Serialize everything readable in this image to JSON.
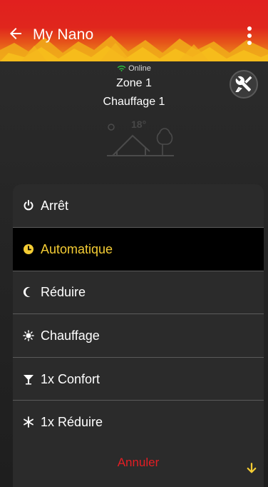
{
  "app_bar": {
    "title": "My Nano",
    "back_icon": "arrow-back-icon",
    "menu_icon": "more-vert-icon"
  },
  "status": {
    "connection": "Online",
    "connection_color": "#2ecc40",
    "zone": "Zone 1",
    "circuit": "Chauffage 1",
    "temperature": "18°"
  },
  "mode_menu": {
    "options": [
      {
        "label": "Arrêt",
        "icon": "power-icon",
        "selected": false
      },
      {
        "label": "Automatique",
        "icon": "clock-icon",
        "selected": true
      },
      {
        "label": "Réduire",
        "icon": "moon-icon",
        "selected": false
      },
      {
        "label": "Chauffage",
        "icon": "sun-icon",
        "selected": false
      },
      {
        "label": "1x Confort",
        "icon": "cocktail-icon",
        "selected": false
      },
      {
        "label": "1x Réduire",
        "icon": "snowflake-icon",
        "selected": false
      }
    ],
    "cancel_label": "Annuler",
    "selected_color": "#f4cc34",
    "cancel_color": "#e31e24"
  }
}
